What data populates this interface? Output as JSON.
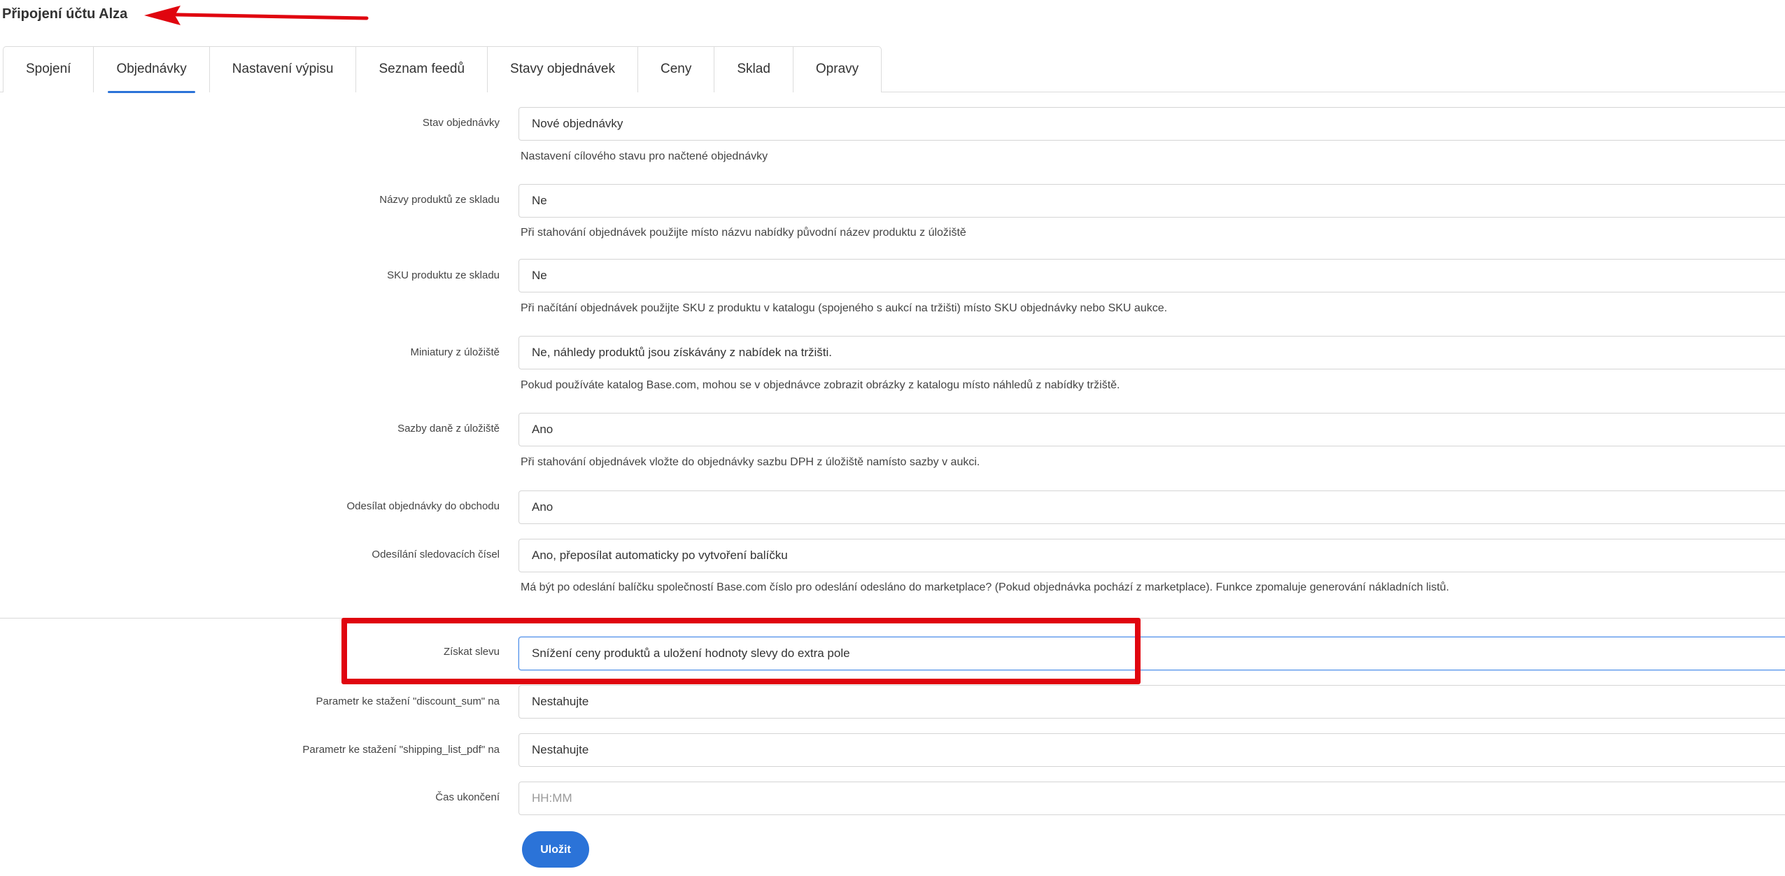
{
  "header": {
    "title": "Připojení účtu Alza",
    "arrow_color": "#e0050f"
  },
  "tabs": [
    {
      "label": "Spojení",
      "active": false
    },
    {
      "label": "Objednávky",
      "active": true
    },
    {
      "label": "Nastavení výpisu",
      "active": false
    },
    {
      "label": "Seznam feedů",
      "active": false
    },
    {
      "label": "Stavy objednávek",
      "active": false
    },
    {
      "label": "Ceny",
      "active": false
    },
    {
      "label": "Sklad",
      "active": false
    },
    {
      "label": "Opravy",
      "active": false
    }
  ],
  "fields": {
    "order_status": {
      "label": "Stav objednávky",
      "value": "Nové objednávky",
      "help": "Nastavení cílového stavu pro načtené objednávky"
    },
    "product_names": {
      "label": "Názvy produktů ze skladu",
      "value": "Ne",
      "help": "Při stahování objednávek použijte místo názvu nabídky původní název produktu z úložiště"
    },
    "product_sku": {
      "label": "SKU produktu ze skladu",
      "value": "Ne",
      "help": "Při načítání objednávek použijte SKU z produktu v katalogu (spojeného s aukcí na tržišti) místo SKU objednávky nebo SKU aukce."
    },
    "thumbnails": {
      "label": "Miniatury z úložiště",
      "value": "Ne, náhledy produktů jsou získávány z nabídek na tržišti.",
      "help": "Pokud používáte katalog Base.com, mohou se v objednávce zobrazit obrázky z katalogu místo náhledů z nabídky tržiště."
    },
    "tax_rates": {
      "label": "Sazby daně z úložiště",
      "value": "Ano",
      "help": "Při stahování objednávek vložte do objednávky sazbu DPH z úložiště namísto sazby v aukci."
    },
    "send_orders": {
      "label": "Odesílat objednávky do obchodu",
      "value": "Ano"
    },
    "tracking_numbers": {
      "label": "Odesílání sledovacích čísel",
      "value": "Ano, přeposílat automaticky po vytvoření balíčku",
      "help": "Má být po odeslání balíčku společností Base.com číslo pro odeslání odesláno do marketplace? (Pokud objednávka pochází z marketplace). Funkce zpomaluje generování nákladních listů."
    },
    "discount": {
      "label": "Získat slevu",
      "value": "Snížení ceny produktů a uložení hodnoty slevy do extra pole"
    },
    "discount_sum": {
      "label": "Parametr ke stažení \"discount_sum\" na",
      "value": "Nestahujte"
    },
    "shipping_list_pdf": {
      "label": "Parametr ke stažení \"shipping_list_pdf\" na",
      "value": "Nestahujte"
    },
    "end_time": {
      "label": "Čas ukončení",
      "placeholder": "HH:MM"
    }
  },
  "actions": {
    "save_label": "Uložit"
  },
  "colors": {
    "accent": "#2b73d8",
    "highlight": "#e0050f"
  }
}
